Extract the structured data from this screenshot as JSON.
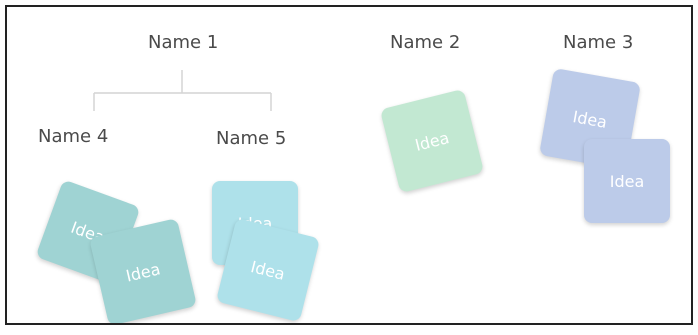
{
  "colors": {
    "teal": "#9fd3d3",
    "teal_dark": "#8cc9c9",
    "cyan": "#aee1ea",
    "mint": "#c2e8d2",
    "lavender": "#bccbe9",
    "tree_line": "#d4d4d4",
    "label_text": "#4a4a4a"
  },
  "names": {
    "name1": "Name 1",
    "name2": "Name 2",
    "name3": "Name 3",
    "name4": "Name 4",
    "name5": "Name 5"
  },
  "cards": {
    "group4_back": "Idea",
    "group4_front": "Idea",
    "group5_back": "Idea",
    "group5_front": "Idea",
    "group2_card": "Idea",
    "group3_back": "Idea",
    "group3_front": "Idea"
  }
}
